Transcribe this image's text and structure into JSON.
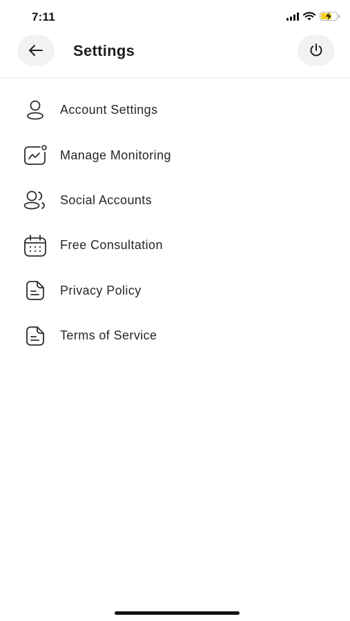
{
  "status_bar": {
    "time": "7:11"
  },
  "header": {
    "title": "Settings"
  },
  "menu": {
    "items": [
      {
        "label": "Account Settings",
        "icon": "user-icon"
      },
      {
        "label": "Manage Monitoring",
        "icon": "chart-monitor-icon"
      },
      {
        "label": "Social Accounts",
        "icon": "users-icon"
      },
      {
        "label": "Free Consultation",
        "icon": "calendar-icon"
      },
      {
        "label": "Privacy Policy",
        "icon": "document-icon"
      },
      {
        "label": "Terms of Service",
        "icon": "document-icon"
      }
    ]
  },
  "colors": {
    "text": "#26272b",
    "button_bg": "#f2f2f4",
    "battery": "#f5d021"
  }
}
